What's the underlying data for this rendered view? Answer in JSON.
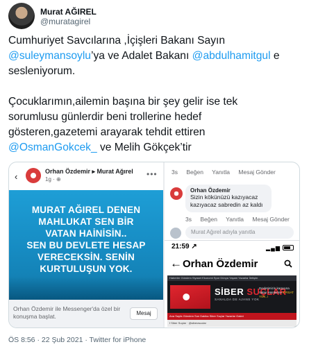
{
  "author": {
    "name": "Murat AĞIREL",
    "handle": "@muratagirel"
  },
  "tweet": {
    "l1": "Cumhuriyet Savcılarına ,İçişleri Bakanı Sayın",
    "l2_m1": "@suleymansoylu",
    "l2_t1": "’ya ve Adalet Bakanı ",
    "l2_m2": "@abdulhamitgul",
    "l2_t2": " e",
    "l3": "sesleniyorum.",
    "p2_l1": "Çocuklarımın,ailemin başına bir şey gelir ise tek",
    "p2_l2": "sorumlusu günlerdir beni trollerine hedef",
    "p2_l3": "gösteren,gazetemi arayarak tehdit ettiren",
    "p2_m3": "@OsmanGokcek_",
    "p2_t3": " ve Melih Gökçek’tir"
  },
  "fb_post": {
    "back_icon": "chevron-left",
    "poster": "Orhan Özdemir ▸ Murat Ağırel",
    "time": "1g · ⊕",
    "more": "•••",
    "card_text": [
      "MURAT AĞIREL DENEN",
      "MAHLUKAT SEN BİR",
      "VATAN HAİNİSİN..",
      "SEN BU DEVLETE HESAP",
      "VERECEKSİN. SENİN",
      "KURTULUŞUN YOK."
    ],
    "card_color": "#1e9ed6",
    "messenger_text": "Orhan Özdemir ile Messenger'da özel bir konuşma başlat.",
    "messenger_button": "Mesaj"
  },
  "fb_comments": {
    "row1": [
      "3s",
      "Beğen",
      "Yanıtla",
      "Mesaj Gönder"
    ],
    "commenter": "Orhan Özdemir",
    "comment": "Sizin kökünüzü kazıyacaz kazıyacaz sabredin az kaldı",
    "row2": [
      "3s",
      "Beğen",
      "Yanıtla",
      "Mesaj Gönder"
    ],
    "reply_placeholder": "Murat Ağırel adıyla yanıtla"
  },
  "phone": {
    "time": "21:59 ↗",
    "signal": "▂▄▆",
    "page_title": "Orhan Özdemir",
    "site_menu": "Haberler  Gündem  Siyaset  Ekonomi  Spor  Dünya  Yaşam  Yazarlar  İletişim",
    "site_logo_a": "SİBER ",
    "site_logo_b": "SUÇLAR",
    "site_tagline": "SANALDA DE AJANS YOK",
    "site_note_a": "Devletimizin karşısına Vatan Hainlerine",
    "site_note_b": "FIRSAT YOK..!",
    "site_nav": "Ana Sayfa   Gündem   Son Dakika   Siber Suçlar   Yazarlar   Galeri",
    "site_footer": "f  Siber Suçlar  ·  @siberzsuclar"
  },
  "meta": "ÖS 8:56 · 22 Şub 2021 · Twitter for iPhone"
}
